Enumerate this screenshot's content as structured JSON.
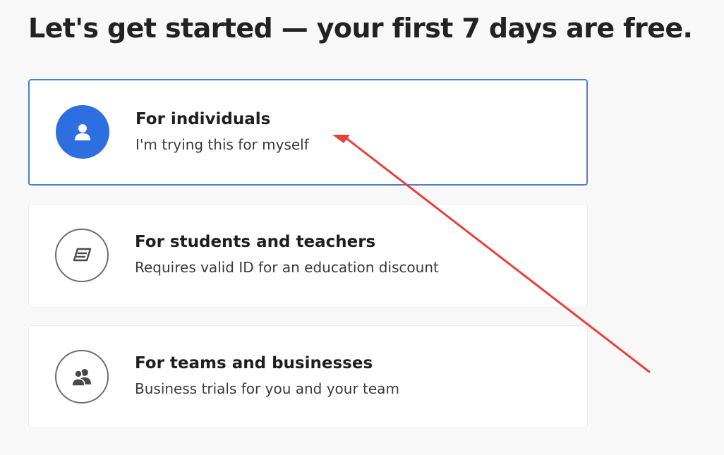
{
  "page": {
    "heading": "Let's get started — your first 7 days are free."
  },
  "options": [
    {
      "title": "For individuals",
      "subtitle": "I'm trying this for myself",
      "icon": "person-icon",
      "selected": true
    },
    {
      "title": "For students and teachers",
      "subtitle": "Requires valid ID for an education discount",
      "icon": "book-icon",
      "selected": false
    },
    {
      "title": "For teams and businesses",
      "subtitle": "Business trials for you and your team",
      "icon": "team-icon",
      "selected": false
    }
  ],
  "colors": {
    "selected_border": "#4b7fc9",
    "selected_icon_bg": "#2d6fe0",
    "annotation_arrow": "#e8413a"
  }
}
